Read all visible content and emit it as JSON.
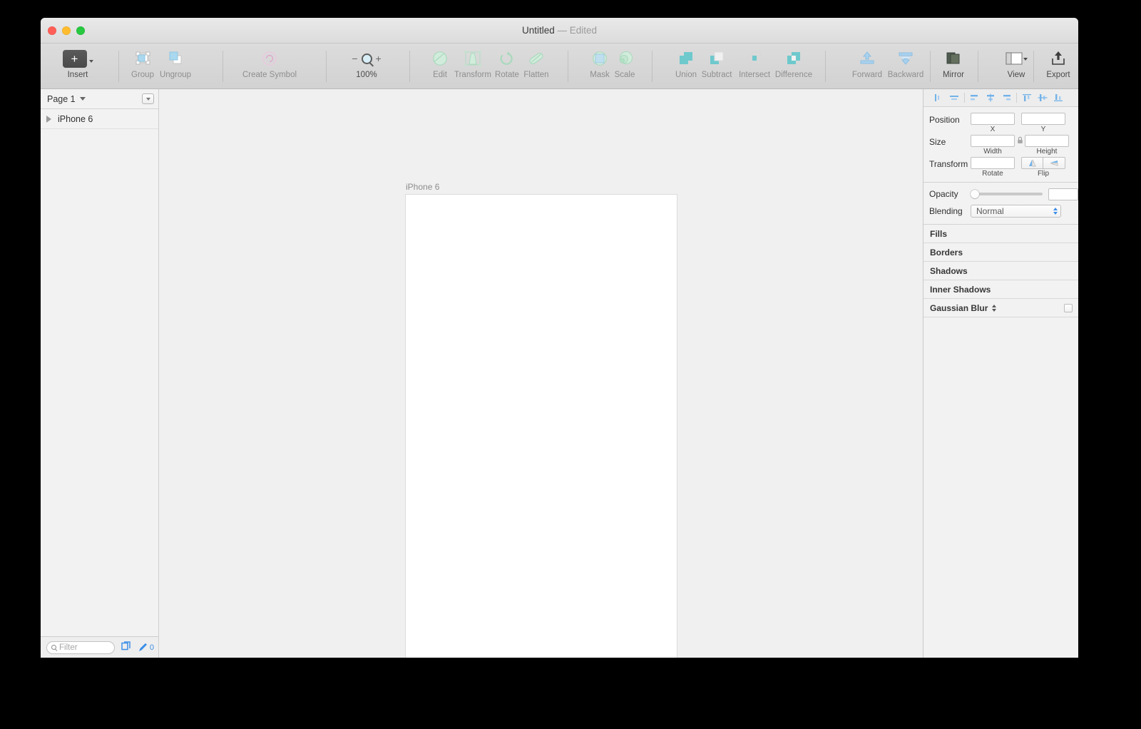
{
  "window": {
    "title": "Untitled",
    "dash": "—",
    "edited": "Edited"
  },
  "toolbar": {
    "items": [
      {
        "label": "Insert",
        "icon": "plus-square-icon",
        "enabled": true
      },
      {
        "label": "Group",
        "icon": "group-icon",
        "enabled": false
      },
      {
        "label": "Ungroup",
        "icon": "ungroup-icon",
        "enabled": false
      },
      {
        "label": "Create Symbol",
        "icon": "create-symbol-icon",
        "enabled": false
      },
      {
        "label": "100%",
        "icon": "zoom-icon",
        "enabled": true
      },
      {
        "label": "Edit",
        "icon": "edit-icon",
        "enabled": false
      },
      {
        "label": "Transform",
        "icon": "transform-icon",
        "enabled": false
      },
      {
        "label": "Rotate",
        "icon": "rotate-icon",
        "enabled": false
      },
      {
        "label": "Flatten",
        "icon": "flatten-icon",
        "enabled": false
      },
      {
        "label": "Mask",
        "icon": "mask-icon",
        "enabled": false
      },
      {
        "label": "Scale",
        "icon": "scale-icon",
        "enabled": false
      },
      {
        "label": "Union",
        "icon": "union-icon",
        "enabled": false
      },
      {
        "label": "Subtract",
        "icon": "subtract-icon",
        "enabled": false
      },
      {
        "label": "Intersect",
        "icon": "intersect-icon",
        "enabled": false
      },
      {
        "label": "Difference",
        "icon": "difference-icon",
        "enabled": false
      },
      {
        "label": "Forward",
        "icon": "forward-icon",
        "enabled": false
      },
      {
        "label": "Backward",
        "icon": "backward-icon",
        "enabled": false
      },
      {
        "label": "Mirror",
        "icon": "mirror-icon",
        "enabled": true
      },
      {
        "label": "View",
        "icon": "view-icon",
        "enabled": true
      },
      {
        "label": "Export",
        "icon": "export-icon",
        "enabled": true
      }
    ],
    "zoom_minus": "−",
    "zoom_plus": "+"
  },
  "sidebar": {
    "page_name": "Page 1",
    "layers": [
      {
        "name": "iPhone 6"
      }
    ],
    "footer": {
      "filter_placeholder": "Filter",
      "count": "0"
    }
  },
  "canvas": {
    "artboard_label": "iPhone 6"
  },
  "inspector": {
    "align_buttons": [
      "align-left-icon",
      "align-center-horizontal-icon",
      "align-left-edges-icon",
      "align-center-icon",
      "align-right-edges-icon",
      "align-top-icon",
      "align-middle-icon",
      "align-bottom-icon"
    ],
    "position": {
      "label": "Position",
      "x_value": "",
      "x_label": "X",
      "y_value": "",
      "y_label": "Y"
    },
    "size": {
      "label": "Size",
      "width_value": "",
      "width_label": "Width",
      "height_value": "",
      "height_label": "Height"
    },
    "transform": {
      "label": "Transform",
      "rotate_value": "",
      "rotate_label": "Rotate",
      "flip_label": "Flip"
    },
    "opacity": {
      "label": "Opacity",
      "value": "",
      "slider_percent": 0
    },
    "blending": {
      "label": "Blending",
      "value": "Normal"
    },
    "sections": [
      {
        "label": "Fills",
        "has_stepper": false,
        "has_check": false
      },
      {
        "label": "Borders",
        "has_stepper": false,
        "has_check": false
      },
      {
        "label": "Shadows",
        "has_stepper": false,
        "has_check": false
      },
      {
        "label": "Inner Shadows",
        "has_stepper": false,
        "has_check": false
      },
      {
        "label": "Gaussian Blur",
        "has_stepper": true,
        "has_check": true
      }
    ]
  },
  "colors": {
    "accent_blue": "#3d8fe8",
    "toolbar_green": "#8fd3a8",
    "toolbar_teal": "#62c3c8",
    "window_bg": "#f6f6f6",
    "canvas_bg": "#f0f0f0"
  }
}
